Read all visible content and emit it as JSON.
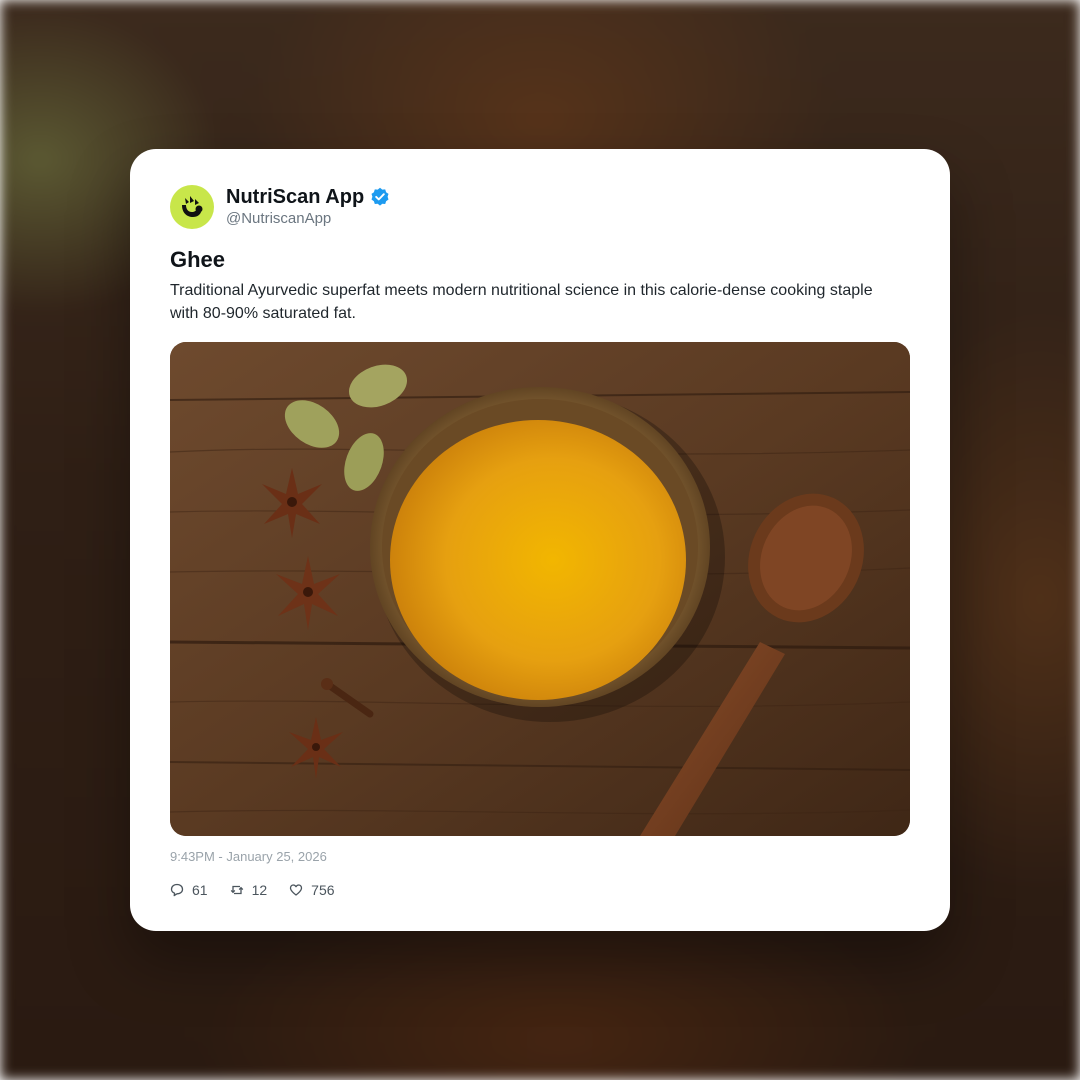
{
  "post": {
    "author": {
      "display_name": "NutriScan App",
      "handle": "@NutriscanApp",
      "verified": true,
      "avatar_icon": "nutriscan-logo-icon",
      "avatar_color": "#c8e64a"
    },
    "title": "Ghee",
    "body": "Traditional Ayurvedic superfat meets modern nutritional science in this calorie-dense cooking staple with 80-90% saturated fat.",
    "timestamp": "9:43PM - January 25, 2026",
    "stats": {
      "replies": "61",
      "reposts": "12",
      "likes": "756"
    },
    "icons": {
      "verified": "verified-badge-icon",
      "reply": "comment-icon",
      "repost": "repost-icon",
      "like": "heart-icon"
    }
  },
  "colors": {
    "verified": "#1d9bf0",
    "text_primary": "#0f1419",
    "text_secondary": "#6b7680",
    "ghee": "#e8a80c"
  }
}
